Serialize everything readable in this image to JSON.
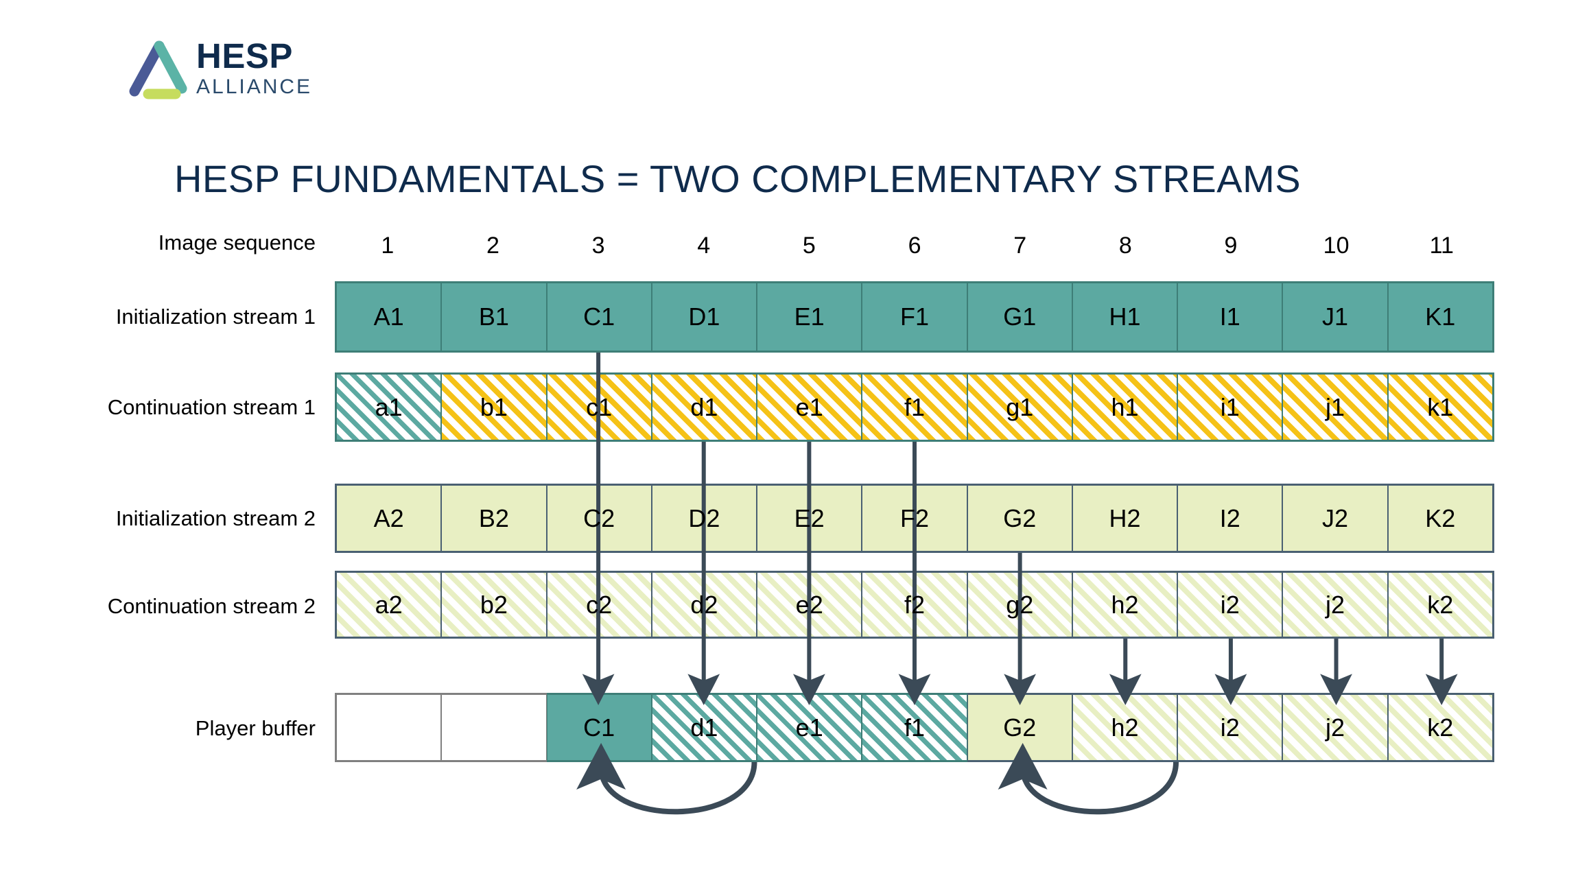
{
  "logo": {
    "name": "HESP",
    "subtitle": "ALLIANCE",
    "mark_colors": [
      "#4A5A96",
      "#5BB3A6",
      "#C6DC5E"
    ]
  },
  "title": "HESP FUNDAMENTALS = TWO COMPLEMENTARY STREAMS",
  "colors": {
    "title_navy": "#0F2B4C",
    "teal": "#5CA9A1",
    "teal_border": "#3E7E77",
    "gold": "#F5C217",
    "pale_green": "#E8EFC3",
    "slate_border": "#4A6072",
    "gray_border": "#808080",
    "arrow": "#3B4A57"
  },
  "labels": {
    "sequence": "Image sequence",
    "init1": "Initialization stream 1",
    "cont1": "Continuation stream 1",
    "init2": "Initialization stream 2",
    "cont2": "Continuation stream 2",
    "player": "Player buffer"
  },
  "sequence": [
    "1",
    "2",
    "3",
    "4",
    "5",
    "6",
    "7",
    "8",
    "9",
    "10",
    "11"
  ],
  "rows": {
    "init1": {
      "label": "Initialization stream 1",
      "cells": [
        {
          "text": "A1",
          "style": "fill-teal"
        },
        {
          "text": "B1",
          "style": "fill-teal"
        },
        {
          "text": "C1",
          "style": "fill-teal"
        },
        {
          "text": "D1",
          "style": "fill-teal"
        },
        {
          "text": "E1",
          "style": "fill-teal"
        },
        {
          "text": "F1",
          "style": "fill-teal"
        },
        {
          "text": "G1",
          "style": "fill-teal"
        },
        {
          "text": "H1",
          "style": "fill-teal"
        },
        {
          "text": "I1",
          "style": "fill-teal"
        },
        {
          "text": "J1",
          "style": "fill-teal"
        },
        {
          "text": "K1",
          "style": "fill-teal"
        }
      ]
    },
    "cont1": {
      "label": "Continuation stream 1",
      "cells": [
        {
          "text": "a1",
          "style": "hatch-teal"
        },
        {
          "text": "b1",
          "style": "hatch-gold"
        },
        {
          "text": "c1",
          "style": "hatch-gold"
        },
        {
          "text": "d1",
          "style": "hatch-gold"
        },
        {
          "text": "e1",
          "style": "hatch-gold"
        },
        {
          "text": "f1",
          "style": "hatch-gold"
        },
        {
          "text": "g1",
          "style": "hatch-gold"
        },
        {
          "text": "h1",
          "style": "hatch-gold"
        },
        {
          "text": "i1",
          "style": "hatch-gold"
        },
        {
          "text": "j1",
          "style": "hatch-gold"
        },
        {
          "text": "k1",
          "style": "hatch-gold"
        }
      ]
    },
    "init2": {
      "label": "Initialization stream 2",
      "cells": [
        {
          "text": "A2",
          "style": "fill-pale"
        },
        {
          "text": "B2",
          "style": "fill-pale"
        },
        {
          "text": "C2",
          "style": "fill-pale"
        },
        {
          "text": "D2",
          "style": "fill-pale"
        },
        {
          "text": "E2",
          "style": "fill-pale"
        },
        {
          "text": "F2",
          "style": "fill-pale"
        },
        {
          "text": "G2",
          "style": "fill-pale"
        },
        {
          "text": "H2",
          "style": "fill-pale"
        },
        {
          "text": "I2",
          "style": "fill-pale"
        },
        {
          "text": "J2",
          "style": "fill-pale"
        },
        {
          "text": "K2",
          "style": "fill-pale"
        }
      ]
    },
    "cont2": {
      "label": "Continuation stream 2",
      "cells": [
        {
          "text": "a2",
          "style": "hatch-pale"
        },
        {
          "text": "b2",
          "style": "hatch-pale"
        },
        {
          "text": "c2",
          "style": "hatch-pale"
        },
        {
          "text": "d2",
          "style": "hatch-pale"
        },
        {
          "text": "e2",
          "style": "hatch-pale"
        },
        {
          "text": "f2",
          "style": "hatch-pale"
        },
        {
          "text": "g2",
          "style": "hatch-pale"
        },
        {
          "text": "h2",
          "style": "hatch-pale"
        },
        {
          "text": "i2",
          "style": "hatch-pale"
        },
        {
          "text": "j2",
          "style": "hatch-pale"
        },
        {
          "text": "k2",
          "style": "hatch-pale"
        }
      ]
    },
    "player": {
      "label": "Player buffer",
      "cells": [
        {
          "text": "",
          "style": "fill-white-gray"
        },
        {
          "text": "",
          "style": "fill-white-gray"
        },
        {
          "text": "C1",
          "style": "fill-teal"
        },
        {
          "text": "d1",
          "style": "hatch-teal"
        },
        {
          "text": "e1",
          "style": "hatch-teal"
        },
        {
          "text": "f1",
          "style": "hatch-teal"
        },
        {
          "text": "G2",
          "style": "fill-pale"
        },
        {
          "text": "h2",
          "style": "hatch-pale"
        },
        {
          "text": "i2",
          "style": "hatch-pale"
        },
        {
          "text": "j2",
          "style": "hatch-pale"
        },
        {
          "text": "k2",
          "style": "hatch-pale"
        }
      ]
    }
  },
  "arrows": {
    "down": [
      {
        "column": 3,
        "from_row": "init1",
        "to_row": "player"
      },
      {
        "column": 4,
        "from_row": "cont1",
        "to_row": "player"
      },
      {
        "column": 5,
        "from_row": "cont1",
        "to_row": "player"
      },
      {
        "column": 6,
        "from_row": "cont1",
        "to_row": "player"
      },
      {
        "column": 7,
        "from_row": "init2",
        "to_row": "player"
      },
      {
        "column": 8,
        "from_row": "cont2",
        "to_row": "player"
      },
      {
        "column": 9,
        "from_row": "cont2",
        "to_row": "player"
      },
      {
        "column": 10,
        "from_row": "cont2",
        "to_row": "player"
      },
      {
        "column": 11,
        "from_row": "cont2",
        "to_row": "player"
      }
    ],
    "loopback": [
      {
        "from_column": 4,
        "to_column": 3
      },
      {
        "from_column": 8,
        "to_column": 7
      }
    ]
  }
}
